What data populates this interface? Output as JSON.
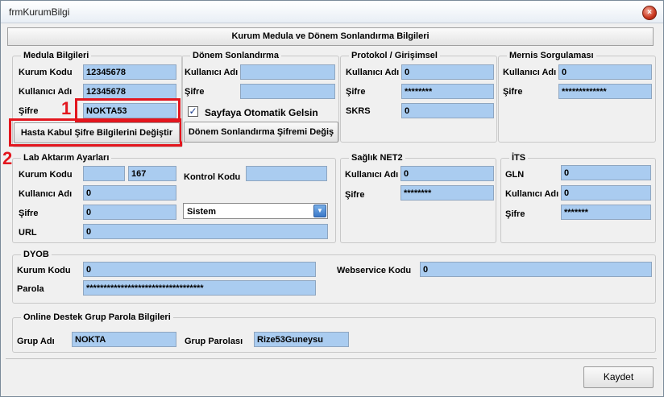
{
  "window": {
    "title": "frmKurumBilgi",
    "close_label": "×"
  },
  "header": {
    "title": "Kurum Medula ve Dönem Sonlandırma Bilgileri"
  },
  "medula": {
    "legend": "Medula Bilgileri",
    "kurum_kodu_label": "Kurum Kodu",
    "kurum_kodu": "12345678",
    "kullanici_adi_label": "Kullanıcı Adı",
    "kullanici_adi": "12345678",
    "sifre_label": "Şifre",
    "sifre": "NOKTA53",
    "change_button": "Hasta Kabul Şifre Bilgilerini Değiştir"
  },
  "donem": {
    "legend": "Dönem Sonlandırma",
    "kullanici_adi_label": "Kullanıcı Adı",
    "kullanici_adi": "",
    "sifre_label": "Şifre",
    "sifre": "",
    "checkbox_label": "Sayfaya Otomatik Gelsin",
    "checkbox_mark": "✓",
    "change_button": "Dönem Sonlandırma Şifremi Değiş"
  },
  "protokol": {
    "legend": "Protokol / Girişimsel",
    "kullanici_adi_label": "Kullanıcı Adı",
    "kullanici_adi": "0",
    "sifre_label": "Şifre",
    "sifre": "********",
    "skrs_label": "SKRS",
    "skrs": "0"
  },
  "mernis": {
    "legend": "Mernis Sorgulaması",
    "kullanici_adi_label": "Kullanıcı Adı",
    "kullanici_adi": "0",
    "sifre_label": "Şifre",
    "sifre": "*************"
  },
  "lab": {
    "legend": "Lab Aktarım Ayarları",
    "kurum_kodu_label": "Kurum Kodu",
    "kurum_kodu_1": "",
    "kurum_kodu_2": "167",
    "kontrol_kodu_label": "Kontrol Kodu",
    "kontrol_kodu": "",
    "kullanici_adi_label": "Kullanıcı Adı",
    "kullanici_adi": "0",
    "sifre_label": "Şifre",
    "sifre": "0",
    "sistem_value": "Sistem",
    "sistem_arrow": "▼",
    "url_label": "URL",
    "url": "0"
  },
  "saglik": {
    "legend": "Sağlık NET2",
    "kullanici_adi_label": "Kullanıcı Adı",
    "kullanici_adi": "0",
    "sifre_label": "Şifre",
    "sifre": "********"
  },
  "its": {
    "legend": "İTS",
    "gln_label": "GLN",
    "gln": "0",
    "kullanici_adi_label": "Kullanıcı Adı",
    "kullanici_adi": "0",
    "sifre_label": "Şifre",
    "sifre": "*******"
  },
  "dyob": {
    "legend": "DYOB",
    "kurum_kodu_label": "Kurum Kodu",
    "kurum_kodu": "0",
    "webservice_label": "Webservice Kodu",
    "webservice": "0",
    "parola_label": "Parola",
    "parola": "**********************************"
  },
  "online": {
    "legend": "Online Destek Grup Parola Bilgileri",
    "grup_adi_label": "Grup Adı",
    "grup_adi": "NOKTA",
    "grup_parolasi_label": "Grup Parolası",
    "grup_parolasi": "Rize53Guneysu"
  },
  "annotations": {
    "one": "1",
    "two": "2"
  },
  "footer": {
    "save_button": "Kaydet"
  },
  "colors": {
    "input_bg": "#aaccf0",
    "annotation_red": "#e3161e"
  }
}
